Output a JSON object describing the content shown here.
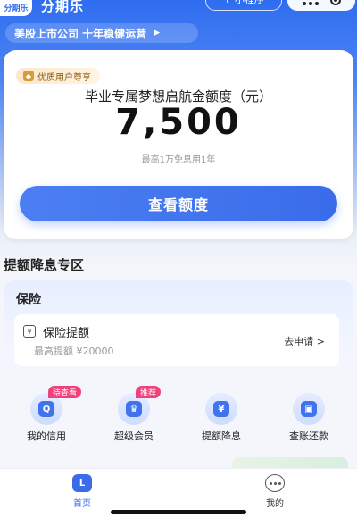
{
  "header": {
    "logo_text": "分期乐",
    "app_name": "分期乐",
    "miniprogram_label": "+ 小程序"
  },
  "banner": {
    "text": "美股上市公司  十年稳健运营",
    "arrow": "▶"
  },
  "main_card": {
    "vip_tag": "优质用户尊享",
    "title": "毕业专属梦想启航金额度（元）",
    "amount": "7,500",
    "note": "最高1万免息用1年",
    "button_label": "查看额度"
  },
  "section": {
    "title": "提额降息专区"
  },
  "insurance": {
    "title": "保险",
    "icon_glyph": "¥",
    "item_name": "保险提额",
    "limit": "最高提额 ¥20000",
    "apply": "去申请 >"
  },
  "quick_menu": [
    {
      "label": "我的信用",
      "badge": "待查看",
      "glyph": "Q"
    },
    {
      "label": "超级会员",
      "badge": "推荐",
      "glyph": "♛"
    },
    {
      "label": "提额降息",
      "badge": "",
      "glyph": "¥"
    },
    {
      "label": "查账还款",
      "badge": "",
      "glyph": "▣"
    }
  ],
  "tabbar": {
    "home": {
      "label": "首页",
      "glyph": "L"
    },
    "mine": {
      "label": "我的"
    }
  },
  "colors": {
    "accent": "#3a6cea",
    "badge": "#f0417a",
    "vip_gold": "#8a5a16"
  }
}
